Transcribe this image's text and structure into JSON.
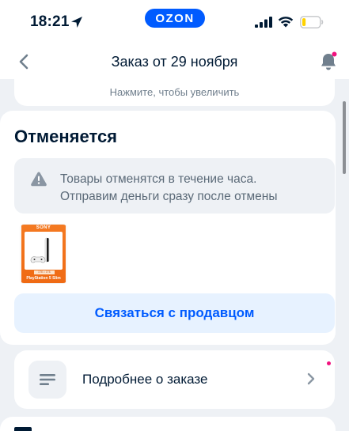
{
  "status_bar": {
    "time": "18:21",
    "brand_badge": "OZON",
    "battery_level_fraction": 0.2,
    "battery_color": "#ffd200",
    "icons": [
      "location-arrow-icon",
      "cellular-signal-icon",
      "wifi-icon",
      "battery-icon"
    ]
  },
  "header": {
    "title": "Заказ от 29 ноября",
    "back_icon": "chevron-left-icon",
    "notification_icon": "bell-icon",
    "notification_dot_color": "#f1117e"
  },
  "zoom_hint": "Нажмите, чтобы увеличить",
  "order_status": {
    "title": "Отменяется",
    "notice_icon": "warning-icon",
    "notice_line_1": "Товары отменятся в течение часа.",
    "notice_line_2": "Отправим деньги сразу после отмены",
    "product": {
      "brand": "SONY",
      "name": "PlayStation 5 Slim",
      "spec": "1ТБ • 1ТБ"
    },
    "contact_button": "Связаться с продавцом"
  },
  "details": {
    "icon": "list-lines-icon",
    "label": "Подробнее о заказе",
    "arrow_icon": "chevron-right-icon"
  },
  "colors": {
    "accent": "#005bff",
    "accent_light": "#e7f2ff",
    "background": "#eef1f5",
    "text_primary": "#001a34",
    "text_secondary": "#5b6a78"
  }
}
